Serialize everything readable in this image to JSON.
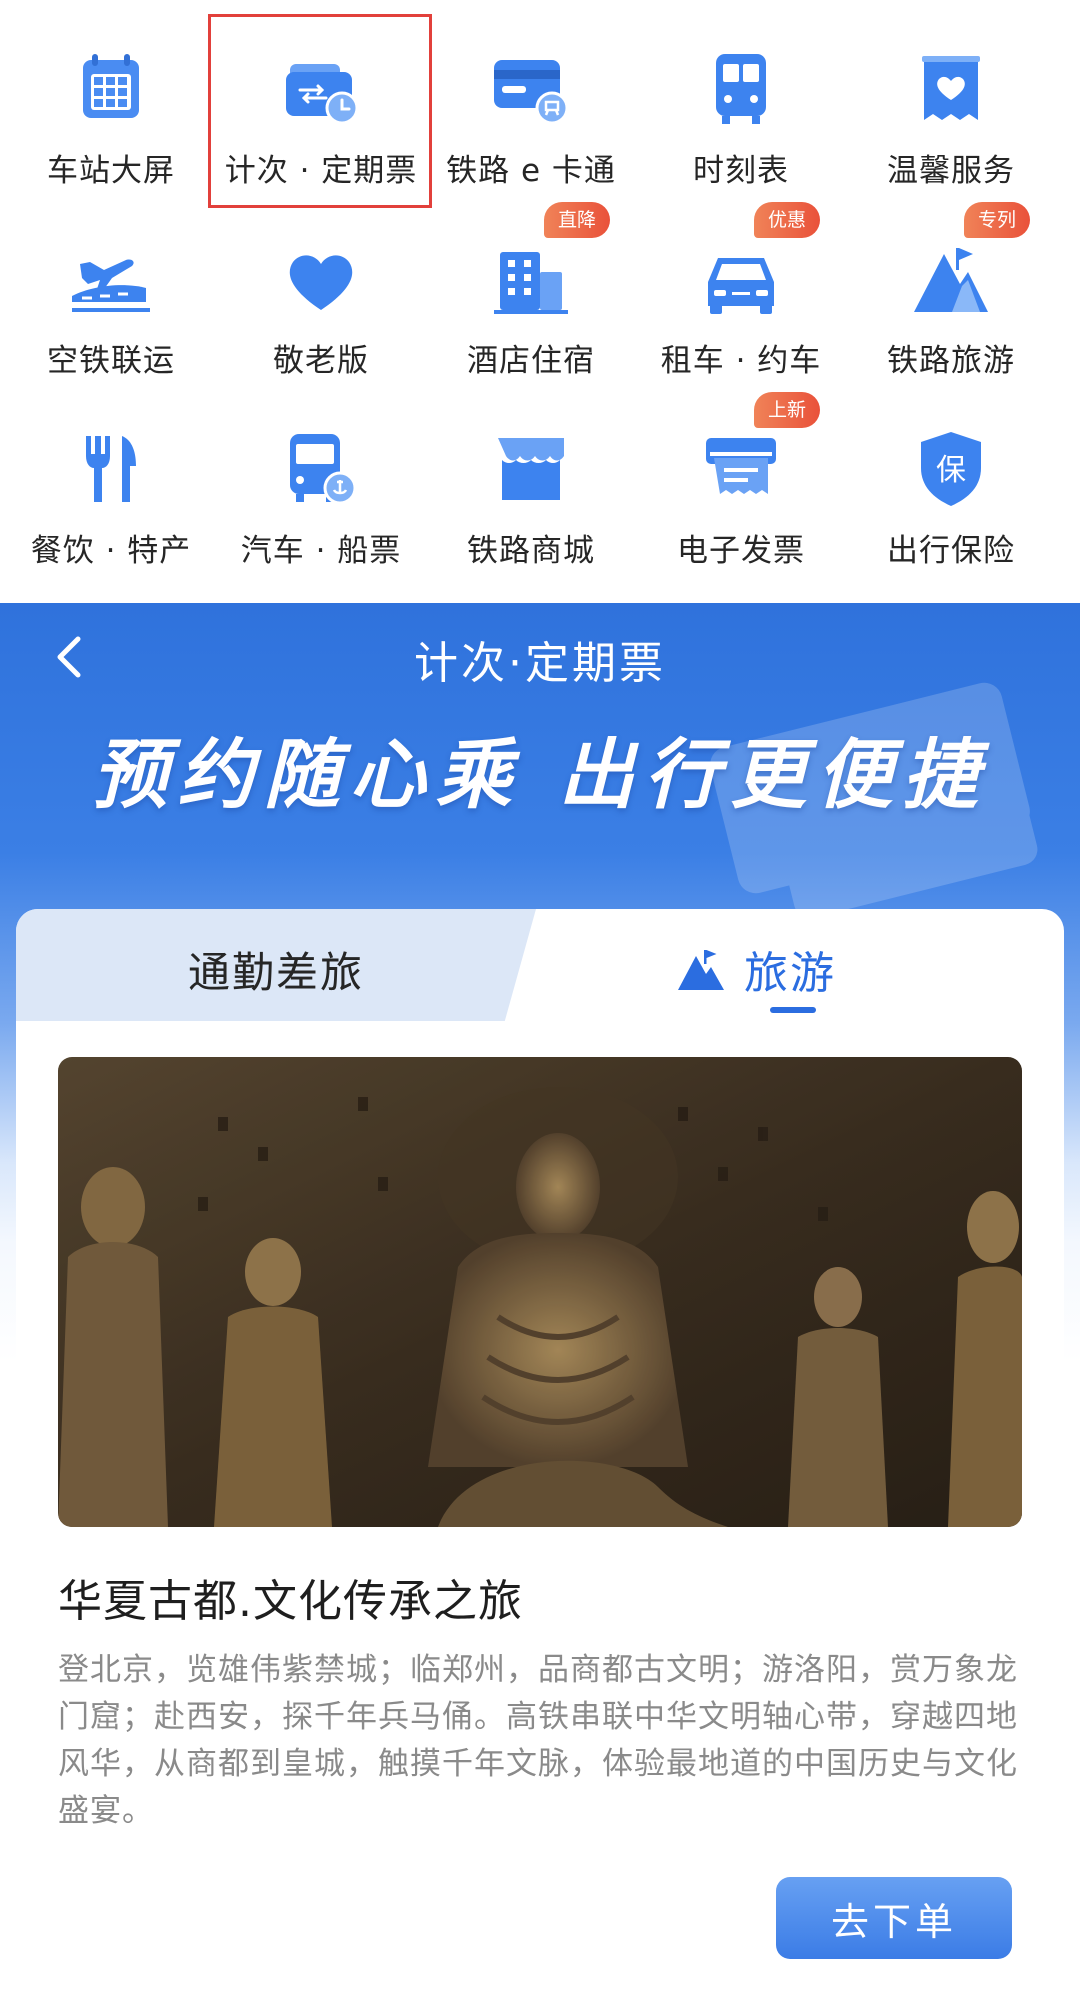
{
  "services": [
    {
      "label": "车站大屏",
      "icon": "station-screen-icon"
    },
    {
      "label": "计次 · 定期票",
      "icon": "ticket-wallet-clock-icon",
      "highlighted": true
    },
    {
      "label": "铁路 e 卡通",
      "icon": "e-card-icon"
    },
    {
      "label": "时刻表",
      "icon": "train-front-icon"
    },
    {
      "label": "温馨服务",
      "icon": "heart-tag-icon"
    },
    {
      "label": "空铁联运",
      "icon": "plane-train-icon"
    },
    {
      "label": "敬老版",
      "icon": "heart-icon"
    },
    {
      "label": "酒店住宿",
      "icon": "hotel-icon",
      "badge": "直降"
    },
    {
      "label": "租车 · 约车",
      "icon": "car-icon",
      "badge": "优惠"
    },
    {
      "label": "铁路旅游",
      "icon": "mountain-icon",
      "badge": "专列"
    },
    {
      "label": "餐饮 · 特产",
      "icon": "fork-knife-icon"
    },
    {
      "label": "汽车 · 船票",
      "icon": "bus-anchor-icon"
    },
    {
      "label": "铁路商城",
      "icon": "shop-icon"
    },
    {
      "label": "电子发票",
      "icon": "printer-icon",
      "badge": "上新"
    },
    {
      "label": "出行保险",
      "icon": "shield-icon",
      "shield_text": "保"
    }
  ],
  "hero": {
    "nav_title": "计次·定期票",
    "slogan": "预约随心乘 出行更便捷"
  },
  "tabs": {
    "commute": "通勤差旅",
    "travel": "旅游",
    "active": "travel"
  },
  "card": {
    "title": "华夏古都.文化传承之旅",
    "description": "登北京，览雄伟紫禁城；临郑州，品商都古文明；游洛阳，赏万象龙门窟；赴西安，探千年兵马俑。高铁串联中华文明轴心带，穿越四地风华，从商都到皇城，触摸千年文脉，体验最地道的中国历史与文化盛宴。",
    "order_button": "去下单",
    "image": "longmen-grottoes-photo"
  },
  "colors": {
    "icon_blue": "#3d83ef",
    "accent": "#2b6de0",
    "badge": "#eb5a3c",
    "highlight_border": "#e2403b"
  }
}
